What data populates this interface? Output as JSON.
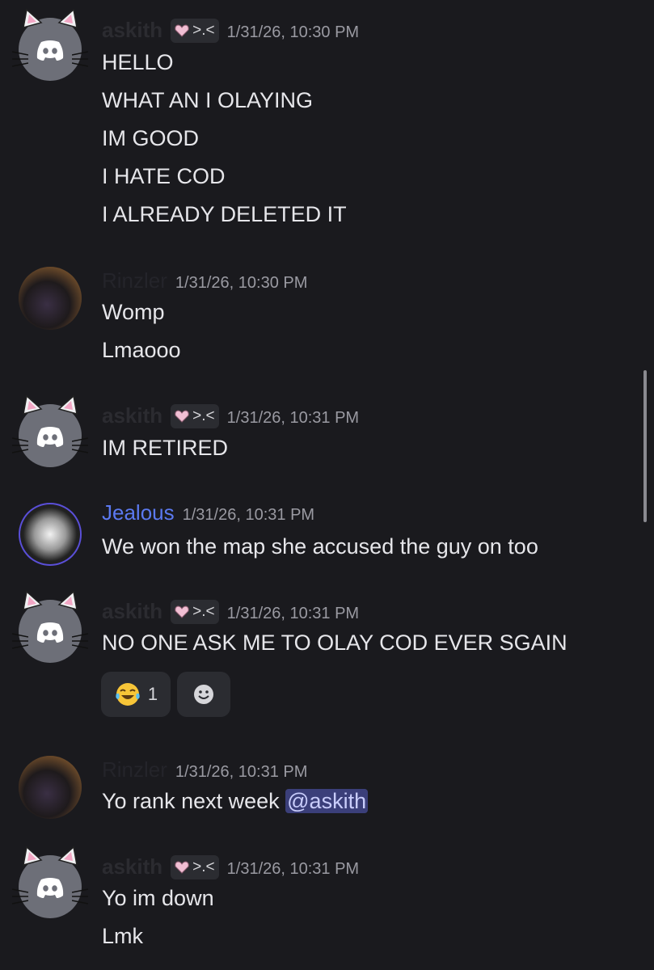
{
  "messages": [
    {
      "author": "askith",
      "tag": ">.<",
      "time": "1/31/26, 10:30 PM",
      "lines": [
        "HELLO",
        "WHAT AN I OLAYING",
        "IM GOOD",
        "I HATE COD",
        "I ALREADY DELETED IT"
      ]
    },
    {
      "author": "Rinzler",
      "time": "1/31/26, 10:30 PM",
      "lines": [
        "Womp",
        "Lmaooo"
      ]
    },
    {
      "author": "askith",
      "tag": ">.<",
      "time": "1/31/26, 10:31 PM",
      "lines": [
        "IM RETIRED"
      ]
    },
    {
      "author": "Jealous",
      "time": "1/31/26, 10:31 PM",
      "lines": [
        "We won the map she accused the guy on too"
      ]
    },
    {
      "author": "askith",
      "tag": ">.<",
      "time": "1/31/26, 10:31 PM",
      "lines": [
        "NO ONE ASK ME TO OLAY COD EVER SGAIN"
      ],
      "reaction_count": "1"
    },
    {
      "author": "Rinzler",
      "time": "1/31/26, 10:31 PM",
      "lines": [
        "Yo rank next week "
      ],
      "mention": "@askith"
    },
    {
      "author": "askith",
      "tag": ">.<",
      "time": "1/31/26, 10:31 PM",
      "lines": [
        "Yo im down",
        "Lmk"
      ]
    }
  ],
  "icons": {
    "laughing_reaction": "tears-of-joy-emoji-icon",
    "add_reaction": "add-reaction-smiley-icon"
  },
  "colors": {
    "background": "#1a1a1e",
    "mention_bg": "#3b3f7a",
    "jealous_name": "#5b79f0"
  }
}
